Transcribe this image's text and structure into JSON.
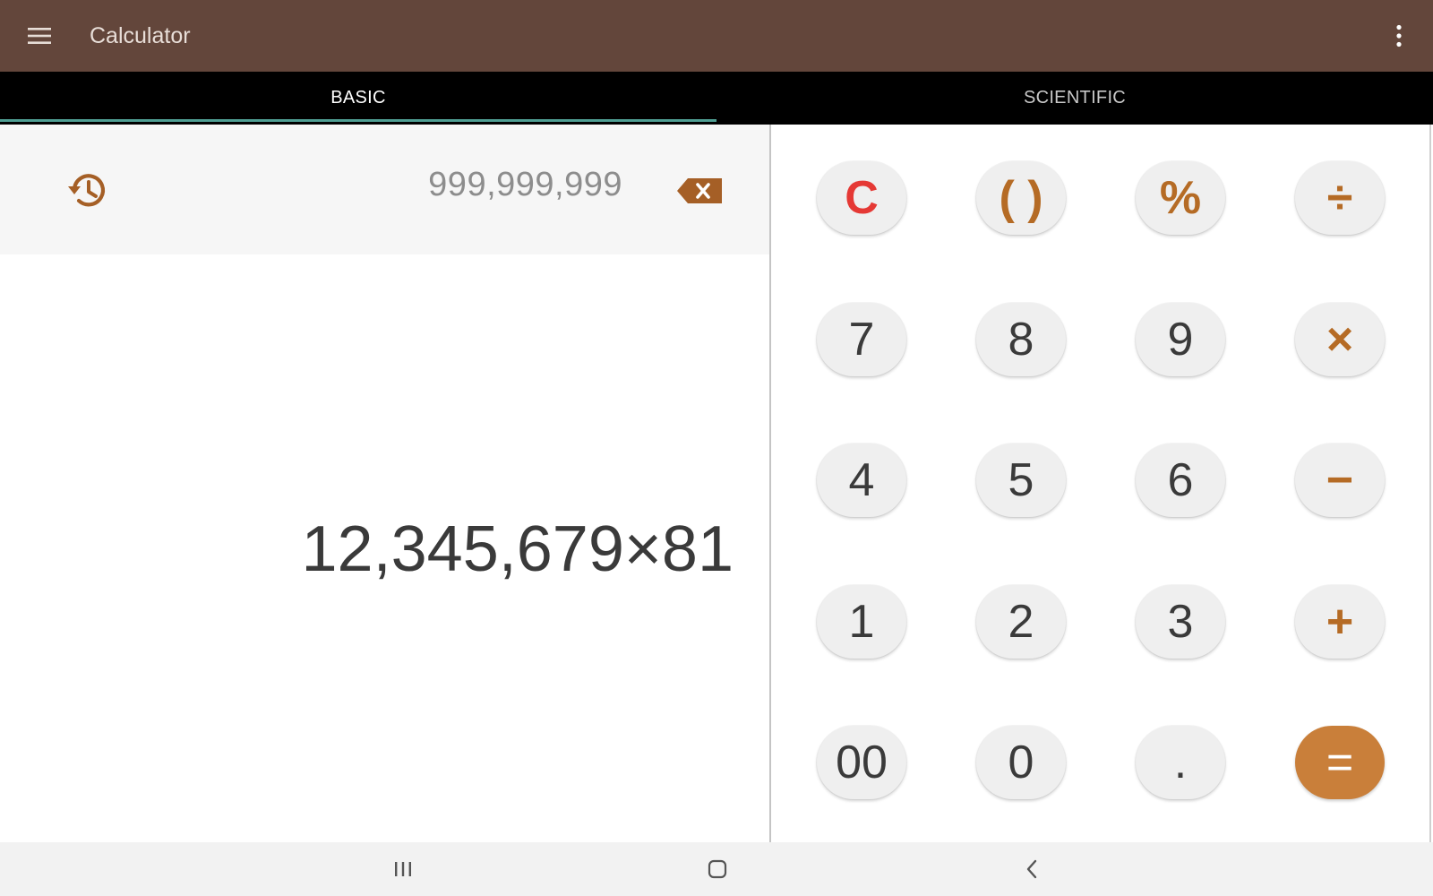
{
  "app": {
    "title": "Calculator"
  },
  "tabs": [
    {
      "label": "BASIC",
      "active": true
    },
    {
      "label": "SCIENTIFIC",
      "active": false
    }
  ],
  "display": {
    "history_value": "999,999,999",
    "expression": "12,345,679×81"
  },
  "keypad": {
    "rows": [
      [
        "C",
        "( )",
        "%",
        "÷"
      ],
      [
        "7",
        "8",
        "9",
        "×"
      ],
      [
        "4",
        "5",
        "6",
        "−"
      ],
      [
        "1",
        "2",
        "3",
        "+"
      ],
      [
        "00",
        "0",
        ".",
        "="
      ]
    ]
  },
  "icons": {
    "menu": "menu-icon",
    "overflow": "more-vert-icon",
    "history": "history-icon",
    "backspace": "backspace-icon",
    "nav_recents": "recent-apps-icon",
    "nav_home": "home-icon",
    "nav_back": "back-icon"
  },
  "colors": {
    "appbar": "#63463b",
    "tab_bar": "#000000",
    "tab_indicator": "#4f9e93",
    "accent_operator": "#b56b25",
    "clear_key": "#e53935",
    "equals_key": "#c97f3a",
    "key_background": "#efefef"
  }
}
